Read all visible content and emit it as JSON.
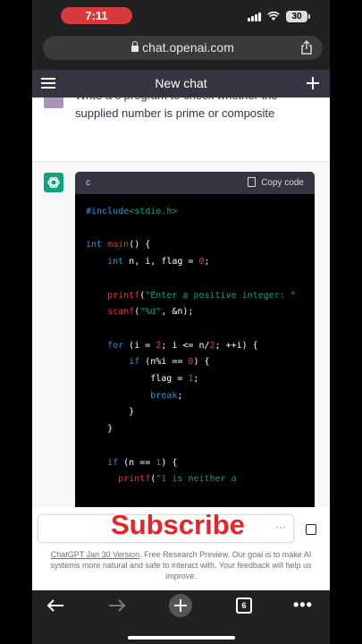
{
  "status_bar": {
    "time": "7:11",
    "battery": "30"
  },
  "browser": {
    "url": "chat.openai.com",
    "tab_count": "6"
  },
  "chat_header": {
    "title": "New chat"
  },
  "user_message": {
    "text": "Write a c program to check whether the supplied number is prime or composite"
  },
  "code_block": {
    "language": "c",
    "copy_label": "Copy code",
    "lines": [
      "#include<stdio.h>",
      "",
      "int main() {",
      "    int n, i, flag = 0;",
      "",
      "    printf(\"Enter a positive integer: \"",
      "    scanf(\"%d\", &n);",
      "",
      "    for (i = 2; i <= n/2; ++i) {",
      "        if (n%i == 0) {",
      "            flag = 1;",
      "            break;",
      "        }",
      "    }",
      "",
      "    if (n == 1) {",
      "      printf(\"1 is neither a"
    ]
  },
  "overlay": {
    "subscribe_text": "Subscribe"
  },
  "input": {
    "more_label": "···"
  },
  "footer": {
    "version_link": "ChatGPT Jan 30 Version",
    "note": ". Free Research Preview. Our goal is to make AI systems more natural and safe to interact with. Your feedback will help us improve."
  },
  "colors": {
    "accent": "#10a37f",
    "subscribe": "#e8232a",
    "time_pill": "#d63a3a"
  }
}
